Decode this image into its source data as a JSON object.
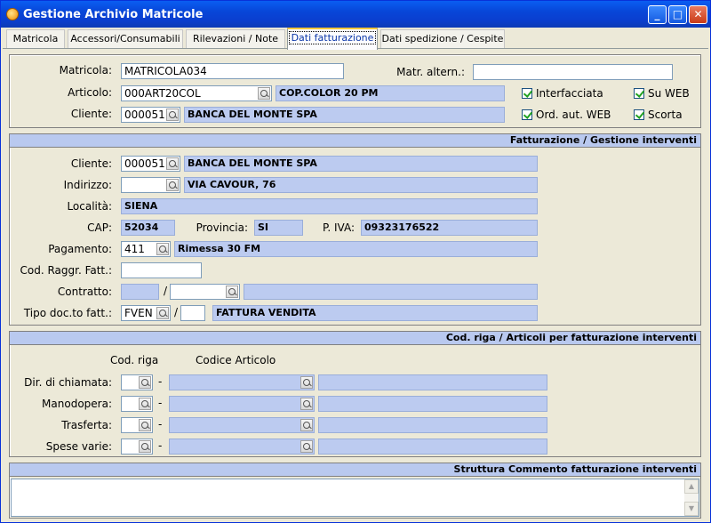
{
  "window": {
    "title": "Gestione Archivio Matricole"
  },
  "tabs": [
    {
      "label": "Matricola"
    },
    {
      "label": "Accessori/Consumabili"
    },
    {
      "label": "Rilevazioni / Note"
    },
    {
      "label": "Dati fatturazione"
    },
    {
      "label": "Dati spedizione / Cespite"
    }
  ],
  "header": {
    "matricola_label": "Matricola:",
    "matricola_value": "MATRICOLA034",
    "matr_altern_label": "Matr. altern.:",
    "matr_altern_value": "",
    "articolo_label": "Articolo:",
    "articolo_code": "000ART20COL",
    "articolo_desc": "COP.COLOR 20 PM",
    "cliente_label": "Cliente:",
    "cliente_code": "000051",
    "cliente_desc": "BANCA DEL MONTE SPA",
    "checks": {
      "interfacciata": "Interfacciata",
      "su_web": "Su WEB",
      "ord_aut_web": "Ord. aut. WEB",
      "scorta": "Scorta"
    }
  },
  "fatturazione": {
    "title": "Fatturazione / Gestione interventi",
    "cliente_label": "Cliente:",
    "cliente_code": "000051",
    "cliente_desc": "BANCA DEL MONTE SPA",
    "indirizzo_label": "Indirizzo:",
    "indirizzo_code": "",
    "indirizzo_desc": "VIA CAVOUR, 76",
    "localita_label": "Località:",
    "localita_value": "SIENA",
    "cap_label": "CAP:",
    "cap_value": "52034",
    "provincia_label": "Provincia:",
    "provincia_value": "SI",
    "piva_label": "P. IVA:",
    "piva_value": "09323176522",
    "pagamento_label": "Pagamento:",
    "pagamento_code": "411",
    "pagamento_desc": "Rimessa 30 FM",
    "codraggr_label": "Cod. Raggr. Fatt.:",
    "codraggr_value": "",
    "contratto_label": "Contratto:",
    "contratto_slash": "/",
    "tipodoc_label": "Tipo doc.to fatt.:",
    "tipodoc_code": "FVEN",
    "tipodoc_slash": "/",
    "tipodoc_desc": "FATTURA VENDITA"
  },
  "codriga": {
    "title": "Cod. riga / Articoli per fatturazione interventi",
    "col_codriga": "Cod. riga",
    "col_codice_articolo": "Codice Articolo",
    "dash": "-",
    "rows": [
      {
        "label": "Dir. di chiamata:"
      },
      {
        "label": "Manodopera:"
      },
      {
        "label": "Trasferta:"
      },
      {
        "label": "Spese varie:"
      }
    ]
  },
  "commento": {
    "title": "Struttura Commento fatturazione interventi"
  }
}
